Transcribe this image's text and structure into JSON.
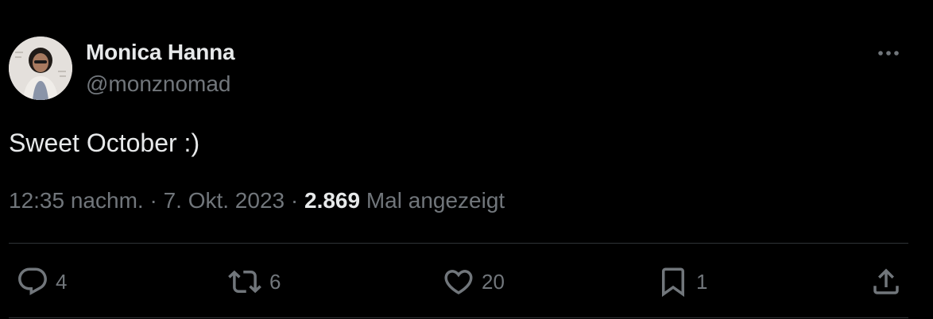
{
  "author": {
    "name": "Monica Hanna",
    "handle": "@monznomad",
    "avatar_icon": "profile-photo"
  },
  "tweet": {
    "text": "Sweet October :)",
    "time": "12:35 nachm.",
    "separator": "·",
    "date": "7. Okt. 2023",
    "views_count": "2.869",
    "views_label": "Mal angezeigt"
  },
  "actions": {
    "reply": {
      "icon": "reply-icon",
      "count": "4"
    },
    "retweet": {
      "icon": "retweet-icon",
      "count": "6"
    },
    "like": {
      "icon": "heart-icon",
      "count": "20"
    },
    "bookmark": {
      "icon": "bookmark-icon",
      "count": "1"
    },
    "share": {
      "icon": "share-icon"
    }
  },
  "colors": {
    "background": "#000000",
    "primary_text": "#e7e9ea",
    "secondary_text": "#71767b",
    "divider": "#2f3336"
  }
}
